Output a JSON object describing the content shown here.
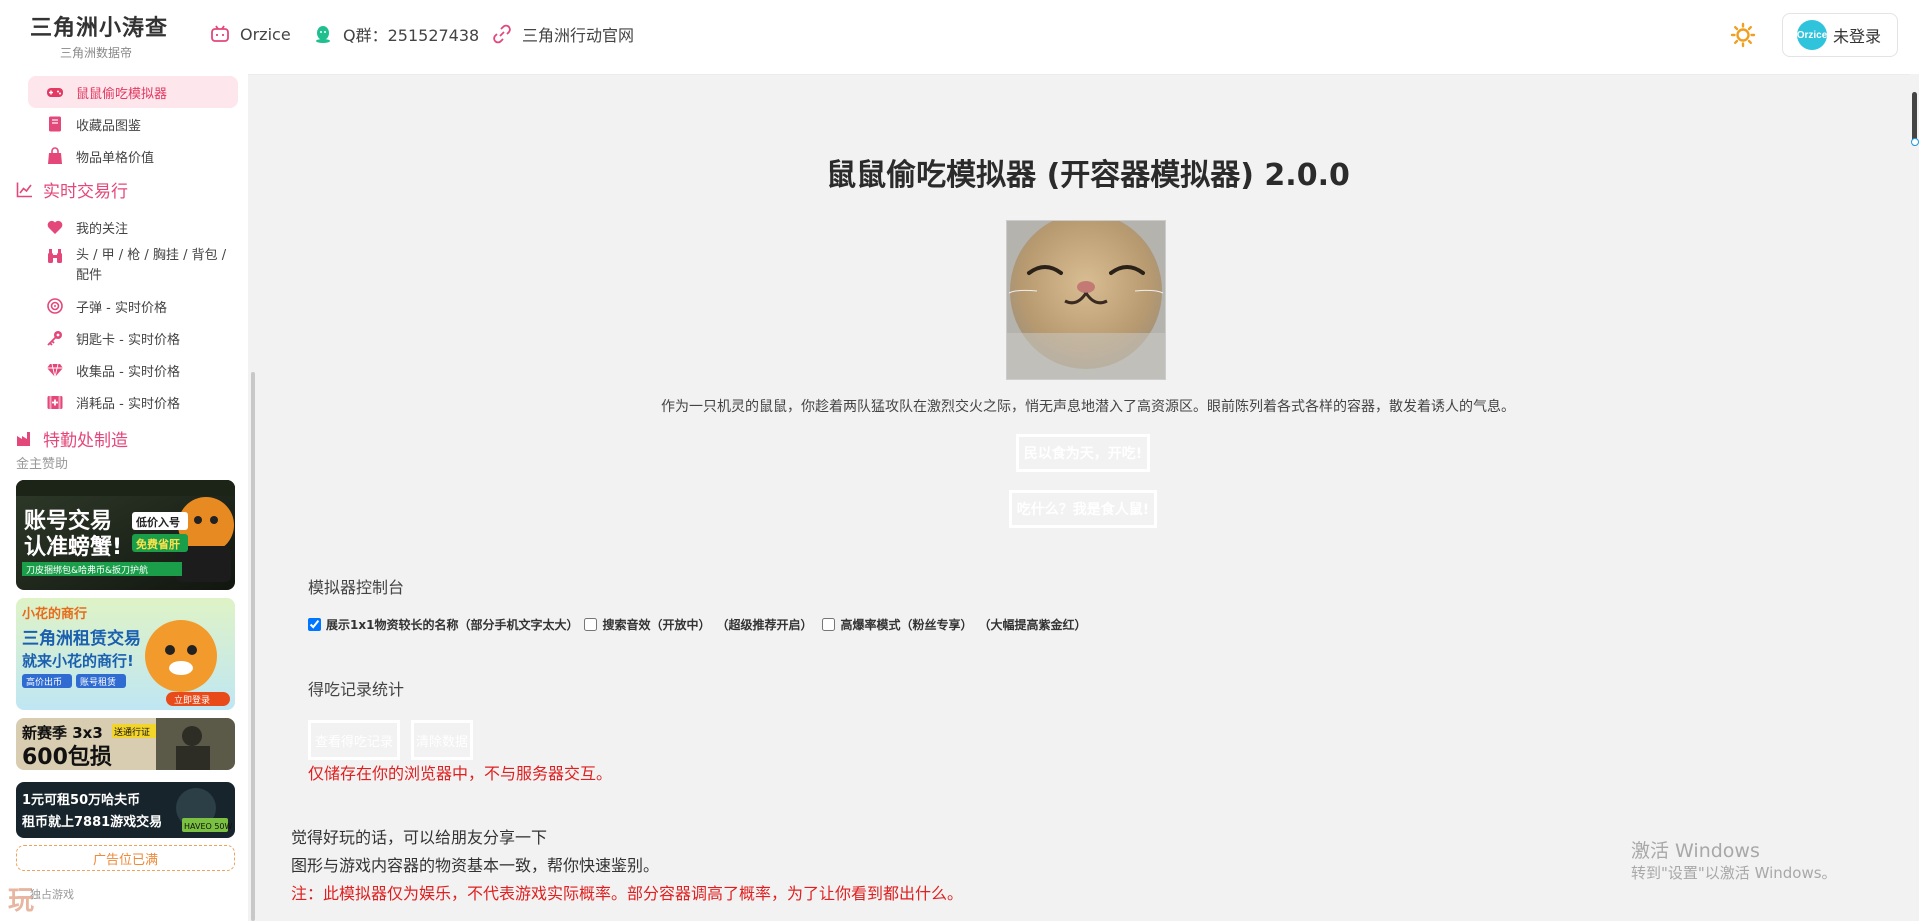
{
  "header": {
    "brand_title": "三角洲小涛查",
    "brand_sub": "三角洲数据帝",
    "nav": [
      {
        "label": "Orzice",
        "icon": "bilibili-icon"
      },
      {
        "label": "Q群：251527438",
        "icon": "qq-icon"
      },
      {
        "label": "三角洲行动官网",
        "icon": "link-icon"
      }
    ],
    "theme_icon": "sun-icon",
    "avatar_text": "Orzice",
    "login_label": "未登录"
  },
  "sidebar": {
    "top_items": [
      {
        "label": "鼠鼠偷吃模拟器",
        "icon": "gamepad-icon",
        "active": true
      },
      {
        "label": "收藏品图鉴",
        "icon": "book-icon"
      },
      {
        "label": "物品单格价值",
        "icon": "bag-icon"
      }
    ],
    "group_trade": {
      "label": "实时交易行",
      "icon": "chart-line-icon"
    },
    "trade_items": [
      {
        "label": "我的关注",
        "icon": "heart-icon"
      },
      {
        "label": "头 / 甲 / 枪 / 胸挂 / 背包 / 配件",
        "icon": "binoculars-icon"
      },
      {
        "label": "子弹 - 实时价格",
        "icon": "target-icon"
      },
      {
        "label": "钥匙卡 - 实时价格",
        "icon": "key-icon"
      },
      {
        "label": "收集品 - 实时价格",
        "icon": "gem-icon"
      },
      {
        "label": "消耗品 - 实时价格",
        "icon": "medkit-icon"
      }
    ],
    "group_craft": {
      "label": "特勤处制造",
      "icon": "factory-icon"
    },
    "sponsor_label": "金主赞助",
    "ads": [
      {
        "line1": "账号交易",
        "line2": "认准螃蟹!",
        "tag1": "低价入号",
        "tag2": "免费省肝",
        "foot": "刀皮捆绑包&哈弗币&扳刀护航"
      },
      {
        "line1": "三角洲租赁交易",
        "line2": "就来小花的商行!",
        "top": "小花的商行",
        "b1": "高价出币",
        "b2": "账号租赁",
        "cta": "立即登录"
      },
      {
        "line1": "新赛季 3x3",
        "line2": "600包损",
        "tag": "送通行证"
      },
      {
        "line1": "1元可租50万哈夫币",
        "line2": "租币就上7881游戏交易",
        "badge": "HAVEO 50W"
      }
    ],
    "ad_full_label": "广告位已满",
    "watermark_logo": "玩",
    "watermark_sub": "独占游戏"
  },
  "main": {
    "title": "鼠鼠偷吃模拟器 (开容器模拟器) 2.0.0",
    "intro": "作为一只机灵的鼠鼠，你趁着两队猛攻队在激烈交火之际，悄无声息地潜入了高资源区。眼前陈列着各式各样的容器，散发着诱人的气息。",
    "start_button": "民以食为天，开吃!",
    "what_button": "吃什么？我是食人鼠!",
    "control_title": "模拟器控制台",
    "controls": [
      {
        "label": "展示1x1物资较长的名称（部分手机文字太大）",
        "checked": true,
        "hint": ""
      },
      {
        "label": "搜索音效（开放中）",
        "checked": false,
        "hint": "（超级推荐开启）"
      },
      {
        "label": "高爆率模式（粉丝专享）",
        "checked": false,
        "hint": "（大幅提高紫金红）"
      }
    ],
    "record_title": "得吃记录统计",
    "view_records": "查看得吃记录",
    "clear_data": "清除数据",
    "storage_warning": "仅储存在你的浏览器中，不与服务器交互。",
    "share_text": "觉得好玩的话，可以给朋友分享一下",
    "same_text": "图形与游戏内容器的物资基本一致，帮你快速鉴别。",
    "note_text": "注：此模拟器仅为娱乐，不代表游戏实际概率。部分容器调高了概率，为了让你看到都出什么。"
  },
  "windows_watermark": {
    "line1": "激活 Windows",
    "line2": "转到\"设置\"以激活 Windows。"
  },
  "colors": {
    "accent": "#e4477a",
    "active_bg": "#fde6ec",
    "warning": "#e02020",
    "avatar_bg": "#30c4dc",
    "sun": "#f0a020"
  }
}
